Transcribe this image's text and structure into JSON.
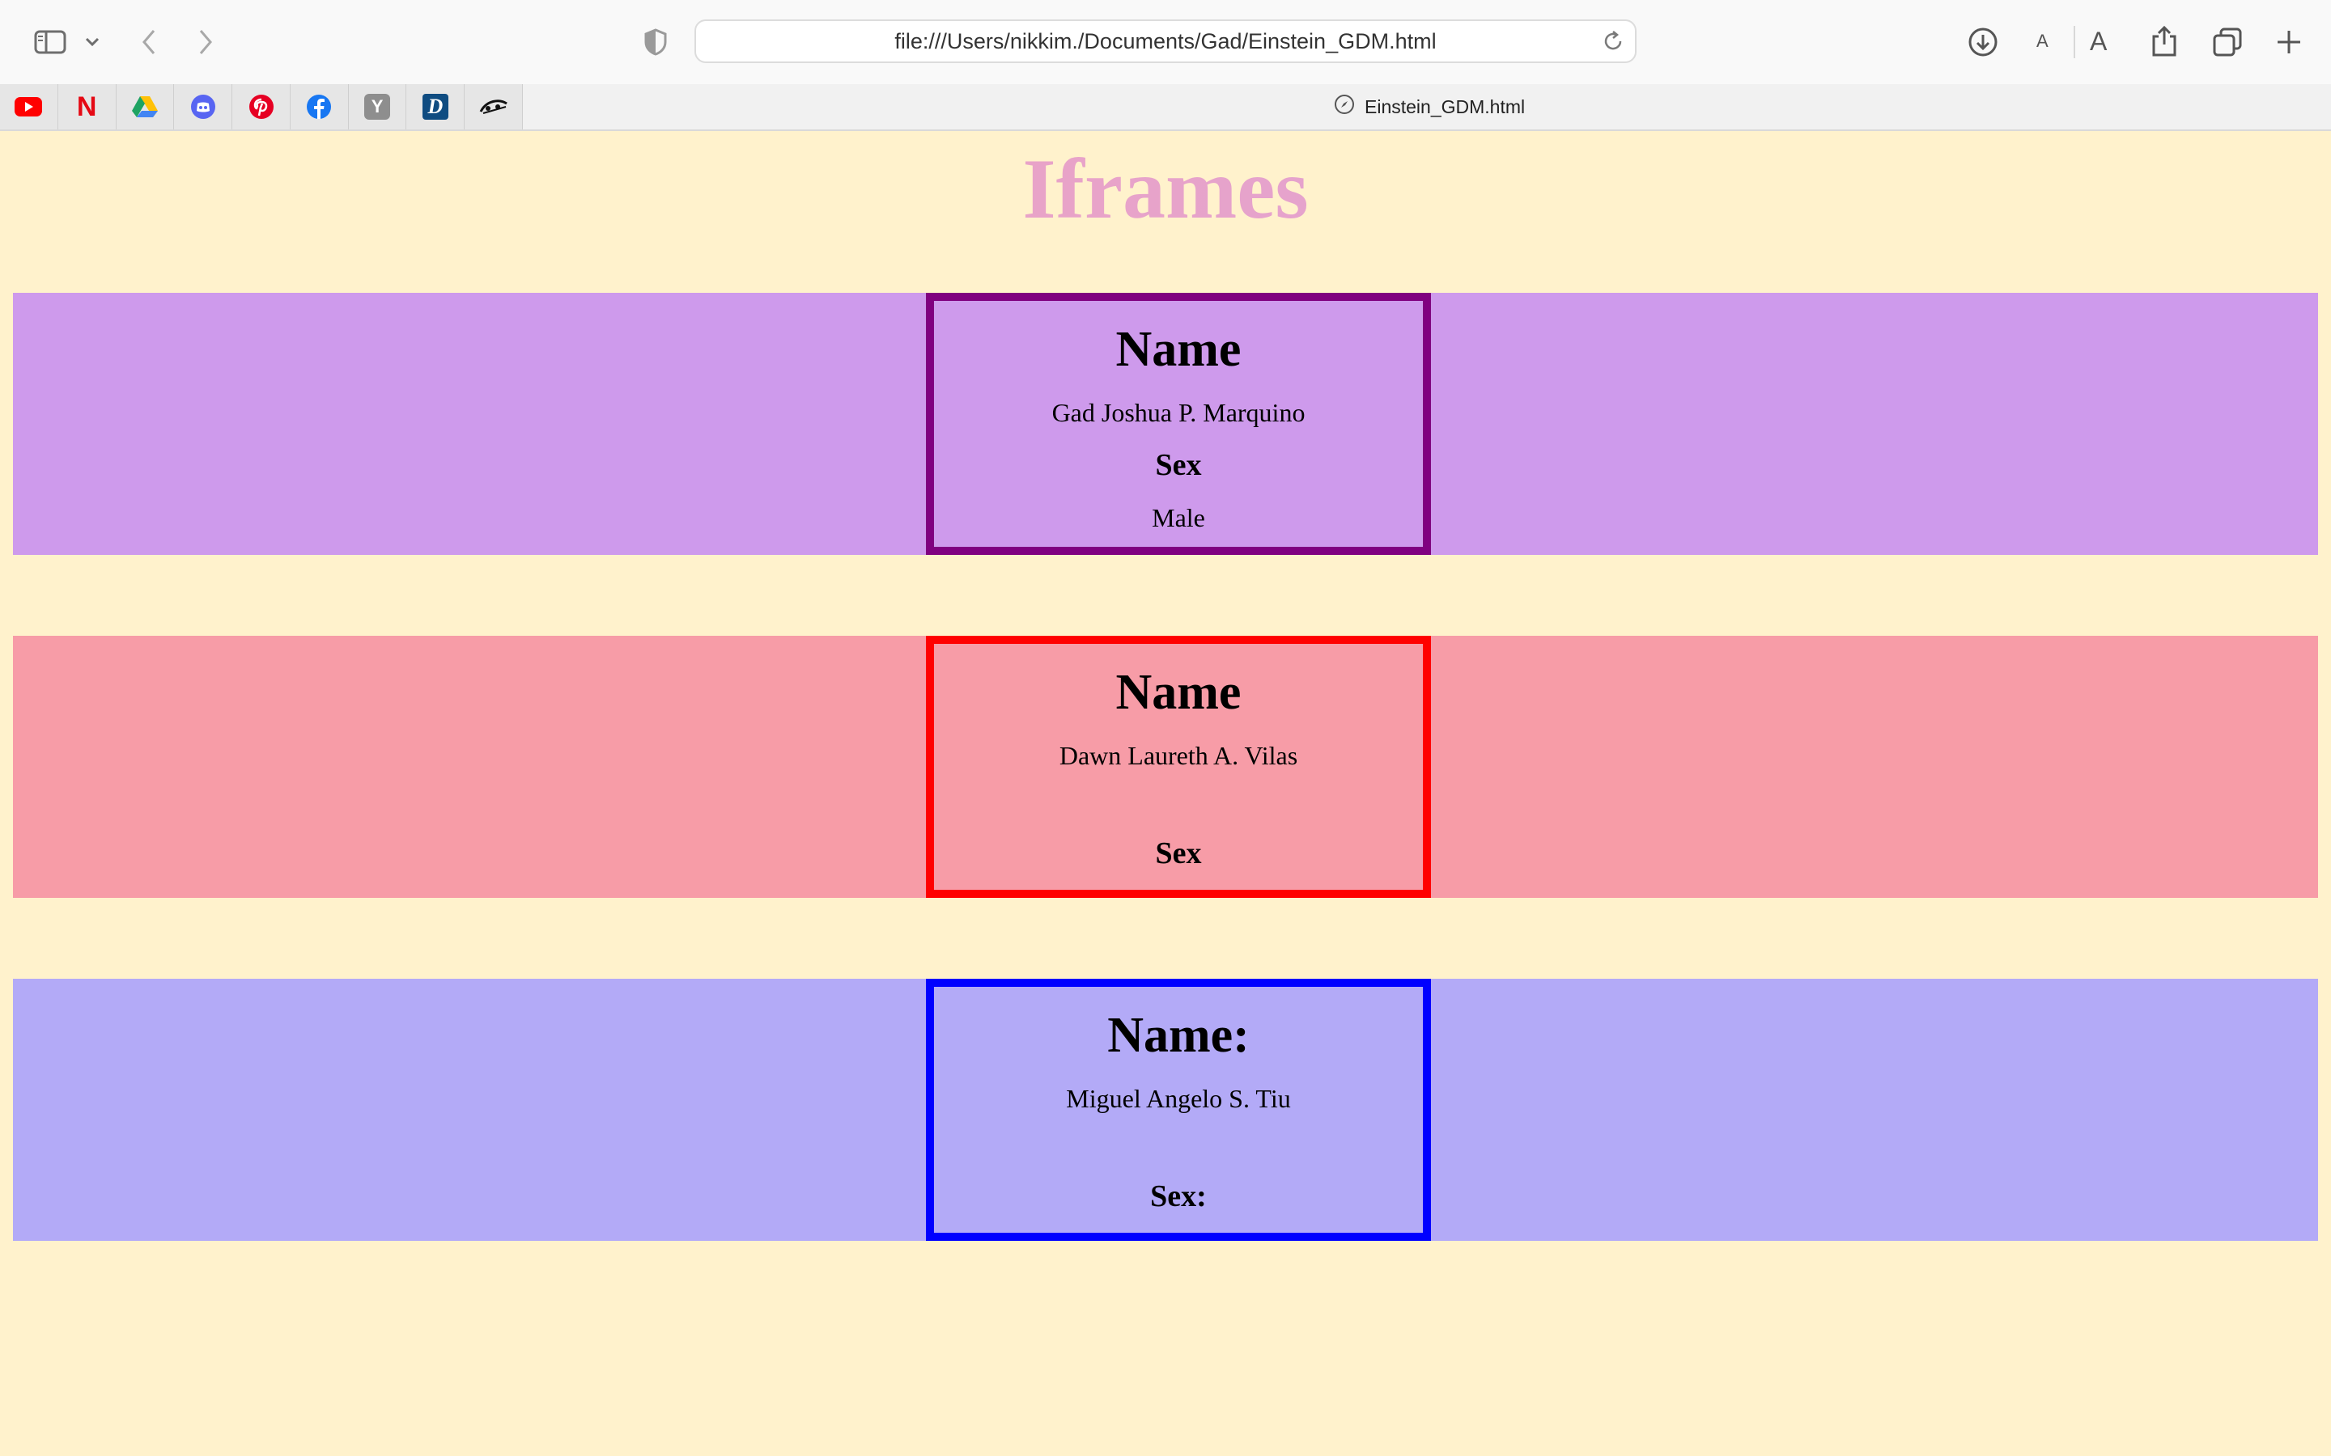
{
  "browser": {
    "address": "file:///Users/nikkim./Documents/Gad/Einstein_GDM.html",
    "tab_title": "Einstein_GDM.html",
    "font_small": "A",
    "font_large": "A",
    "favorites": [
      "youtube-icon",
      "netflix-icon",
      "google-drive-icon",
      "discord-icon",
      "pinterest-icon",
      "facebook-icon",
      "y-combinator-icon",
      "d-icon",
      "logo-icon"
    ],
    "netflix_letter": "N",
    "yc_letter": "Y",
    "d_letter": "D"
  },
  "page": {
    "title": "Iframes",
    "background": "#fff2cc",
    "title_gradient": [
      "#f5a3b8",
      "#d9a3dc"
    ]
  },
  "iframes": [
    {
      "name_heading": "Name",
      "name": "Gad Joshua P. Marquino",
      "sex_heading": "Sex",
      "sex": "Male",
      "background": "#ce9aec",
      "border": "#800080"
    },
    {
      "name_heading": "Name",
      "name": "Dawn Laureth A. Vilas",
      "sex_heading": "Sex",
      "background": "#f79ca7",
      "border": "#ff0000"
    },
    {
      "name_heading": "Name:",
      "name": "Miguel Angelo S. Tiu",
      "sex_heading": "Sex:",
      "background": "#b3aaf7",
      "border": "#0000ff"
    }
  ]
}
